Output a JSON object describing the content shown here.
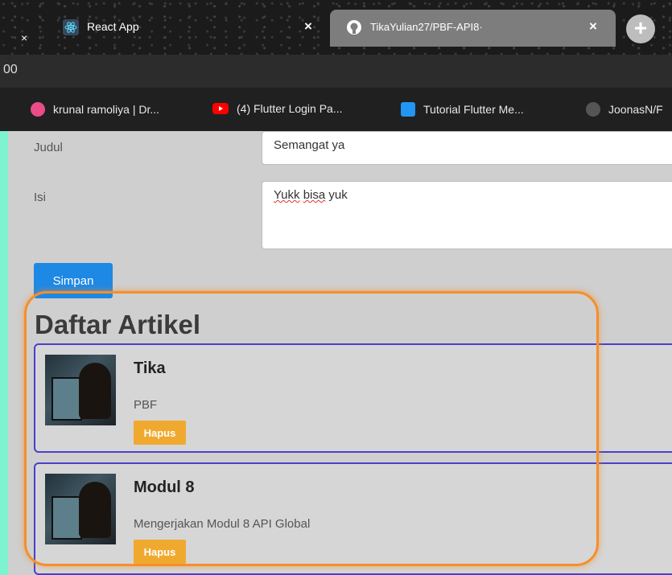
{
  "browser": {
    "tabs": [
      {
        "title": "React App",
        "close": "×"
      },
      {
        "title": "TikaYulian27/PBF-API8·",
        "close": "×"
      }
    ],
    "left_close": "×",
    "new_tab": "+",
    "address": "00",
    "bookmarks": [
      {
        "label": "krunal ramoliya | Dr...",
        "icon": "dribbble-icon",
        "color": "#ea4c89"
      },
      {
        "label": "(4) Flutter Login Pa...",
        "icon": "youtube-icon",
        "color": "#ff0000"
      },
      {
        "label": "Tutorial Flutter Me...",
        "icon": "flutter-icon",
        "color": "#2196f3"
      },
      {
        "label": "JoonasN/F",
        "icon": "github-icon",
        "color": "#555555"
      }
    ]
  },
  "form": {
    "judul_label": "Judul",
    "judul_value": "Semangat ya",
    "isi_label": "Isi",
    "isi_value_word1": "Yukk",
    "isi_value_word2": "bisa",
    "isi_value_rest": " yuk",
    "save_label": "Simpan"
  },
  "list": {
    "heading": "Daftar Artikel",
    "articles": [
      {
        "title": "Tika",
        "body": "PBF",
        "delete_label": "Hapus"
      },
      {
        "title": "Modul 8",
        "body": "Mengerjakan Modul 8 API Global",
        "delete_label": "Hapus"
      }
    ]
  },
  "colors": {
    "accent_button": "#1e88e5",
    "delete_button": "#f0a92f",
    "card_border": "#4a3fc9",
    "highlight": "#f58f2b",
    "left_stripe": "#7ef3cf"
  }
}
